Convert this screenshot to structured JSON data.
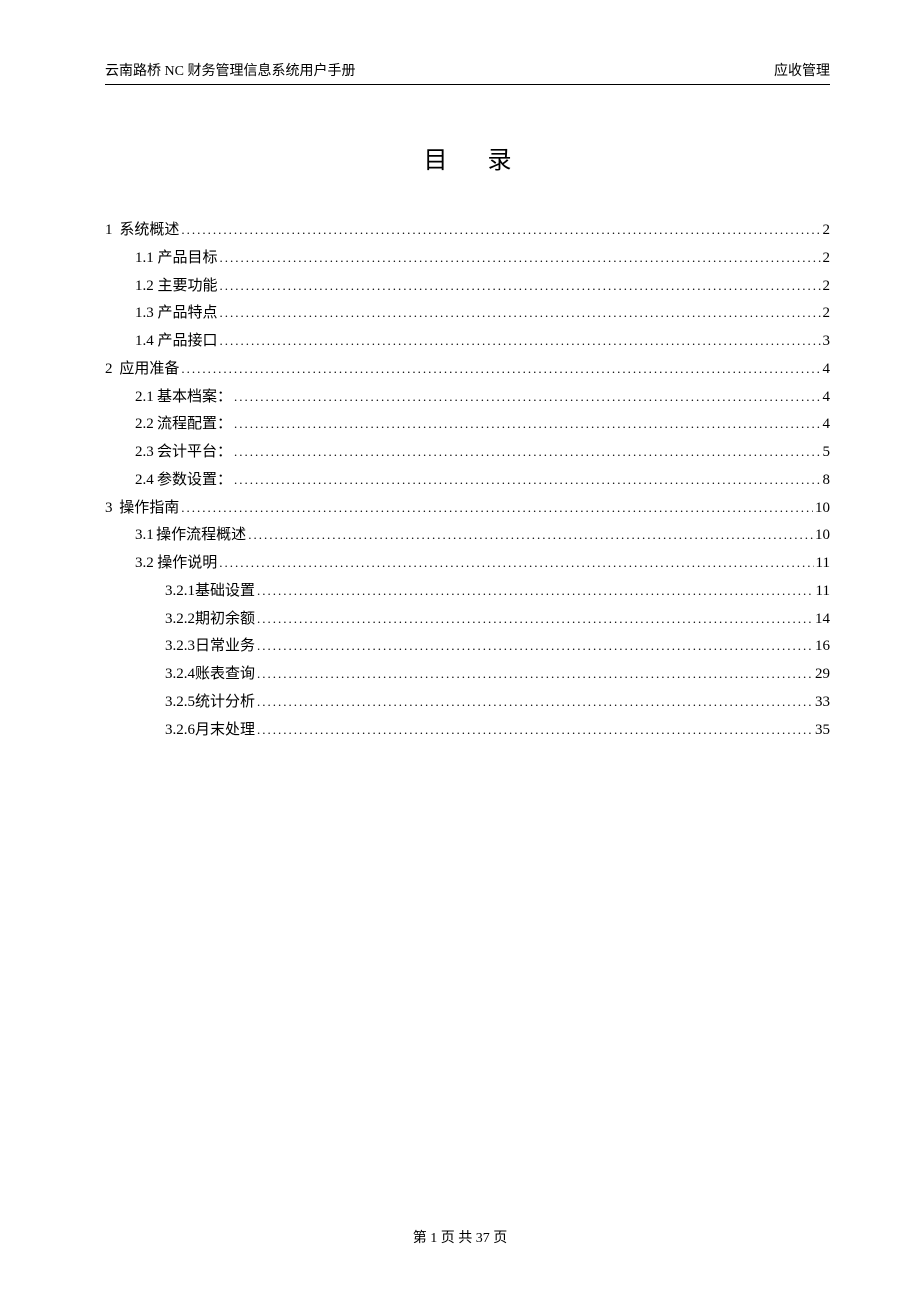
{
  "header": {
    "left": "云南路桥 NC 财务管理信息系统用户手册",
    "right": "应收管理"
  },
  "title": "目录",
  "toc": [
    {
      "level": 1,
      "num": "1",
      "label": "系统概述",
      "page": "2"
    },
    {
      "level": 2,
      "num": "1.1",
      "label": "产品目标",
      "page": "2"
    },
    {
      "level": 2,
      "num": "1.2",
      "label": "主要功能",
      "page": "2"
    },
    {
      "level": 2,
      "num": "1.3",
      "label": "产品特点",
      "page": "2"
    },
    {
      "level": 2,
      "num": "1.4",
      "label": "产品接口",
      "page": "3"
    },
    {
      "level": 1,
      "num": "2",
      "label": "应用准备",
      "page": "4"
    },
    {
      "level": 2,
      "num": "2.1",
      "label": "基本档案：",
      "page": "4"
    },
    {
      "level": 2,
      "num": "2.2",
      "label": "流程配置：",
      "page": "4"
    },
    {
      "level": 2,
      "num": "2.3",
      "label": "会计平台：",
      "page": "5"
    },
    {
      "level": 2,
      "num": "2.4",
      "label": "参数设置：",
      "page": "8"
    },
    {
      "level": 1,
      "num": "3",
      "label": "操作指南",
      "page": "10"
    },
    {
      "level": 2,
      "num": "3.1",
      "label": "操作流程概述",
      "page": "10"
    },
    {
      "level": 2,
      "num": "3.2",
      "label": "操作说明",
      "page": "11"
    },
    {
      "level": 3,
      "num": "3.2.1",
      "label": "基础设置",
      "page": "11"
    },
    {
      "level": 3,
      "num": "3.2.2",
      "label": "期初余额",
      "page": "14"
    },
    {
      "level": 3,
      "num": "3.2.3",
      "label": "日常业务",
      "page": "16"
    },
    {
      "level": 3,
      "num": "3.2.4",
      "label": "账表查询",
      "page": "29"
    },
    {
      "level": 3,
      "num": "3.2.5",
      "label": "统计分析",
      "page": "33"
    },
    {
      "level": 3,
      "num": "3.2.6",
      "label": "月末处理",
      "page": "35"
    }
  ],
  "footer": "第 1 页 共 37 页"
}
